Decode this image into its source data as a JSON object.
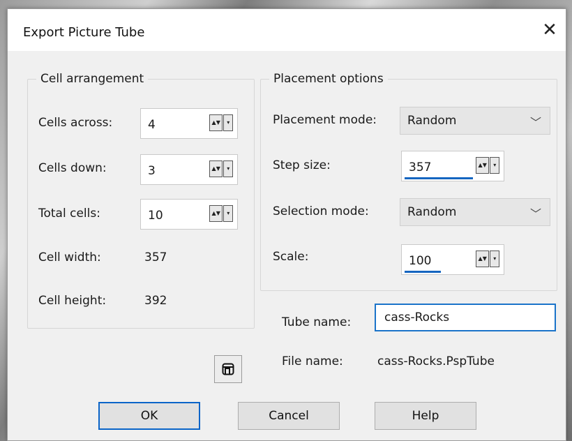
{
  "dialog": {
    "title": "Export Picture Tube",
    "close_symbol": "✕"
  },
  "cell_arrangement": {
    "legend": "Cell arrangement",
    "cells_across": {
      "label": "Cells across:",
      "value": "4"
    },
    "cells_down": {
      "label": "Cells down:",
      "value": "3"
    },
    "total_cells": {
      "label": "Total cells:",
      "value": "10"
    },
    "cell_width": {
      "label": "Cell width:",
      "value": "357"
    },
    "cell_height": {
      "label": "Cell height:",
      "value": "392"
    }
  },
  "placement_options": {
    "legend": "Placement options",
    "placement_mode": {
      "label": "Placement mode:",
      "value": "Random"
    },
    "step_size": {
      "label": "Step size:",
      "value": "357"
    },
    "selection_mode": {
      "label": "Selection mode:",
      "value": "Random"
    },
    "scale": {
      "label": "Scale:",
      "value": "100"
    }
  },
  "tube_name": {
    "label": "Tube name:",
    "value": "cass-Rocks"
  },
  "file_name": {
    "label": "File name:",
    "value": "cass-Rocks.PspTube"
  },
  "buttons": {
    "ok": "OK",
    "cancel": "Cancel",
    "help": "Help"
  },
  "icons": {
    "lock_ratio": "link-ratio-icon",
    "spin_arrows": "spin-arrows-icon",
    "chevron": "chevron-down-icon"
  },
  "colors": {
    "accent": "#0a64c8",
    "focus_underline": "#1565c0"
  }
}
